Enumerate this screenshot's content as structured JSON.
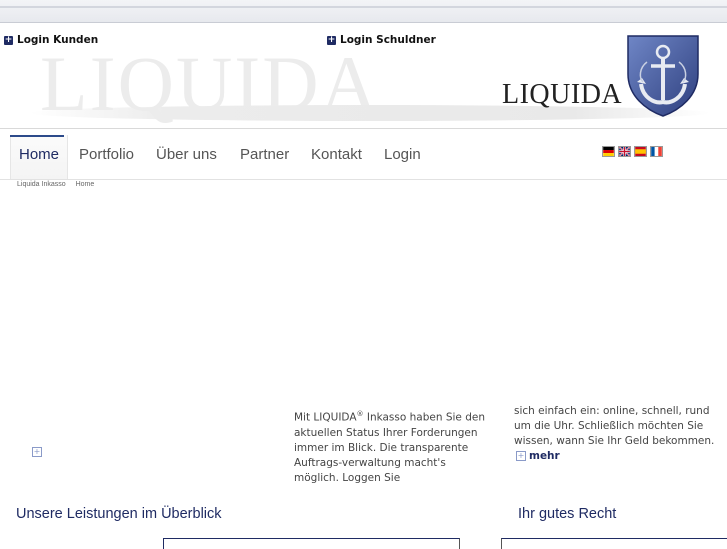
{
  "header": {
    "login_kunden": "Login Kunden",
    "login_schuldner": "Login Schuldner",
    "watermark": "LIQUIDA",
    "brand": "LIQUIDA"
  },
  "nav": {
    "items": [
      {
        "label": "Home",
        "active": true
      },
      {
        "label": "Portfolio"
      },
      {
        "label": "Über uns"
      },
      {
        "label": "Partner"
      },
      {
        "label": "Kontakt"
      },
      {
        "label": "Login"
      }
    ]
  },
  "flags": [
    "german-flag-icon",
    "uk-flag-icon",
    "spanish-flag-icon",
    "french-flag-icon"
  ],
  "breadcrumb": [
    "Liquida Inkasso",
    "Home"
  ],
  "intro": {
    "col1_a": "Mit LIQUIDA",
    "col1_sup": "®",
    "col1_b": " Inkasso haben Sie den aktuellen Status Ihrer Forderungen immer im Blick. Die transparente Auftrags-verwaltung macht's möglich. Loggen Sie",
    "col2": "sich einfach ein: online, schnell, rund um die Uhr. Schließlich möchten Sie wissen, wann Sie Ihr Geld bekommen.",
    "mehr": "mehr"
  },
  "sections": {
    "leistungen": "Unsere Leistungen im Überblick",
    "recht": "Ihr gutes Recht"
  },
  "colors": {
    "navy": "#1f2b63",
    "accent": "#2c4a8a"
  }
}
